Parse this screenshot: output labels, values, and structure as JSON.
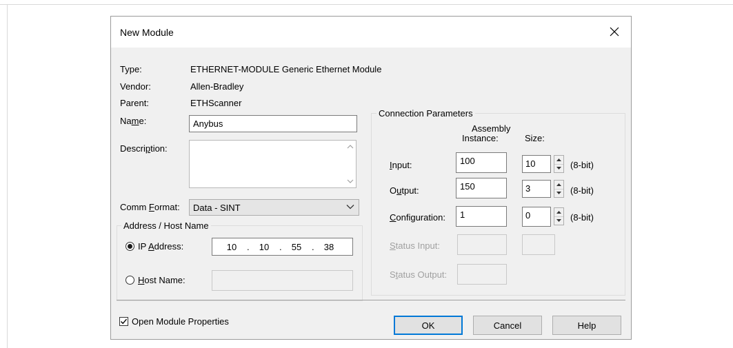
{
  "dialog": {
    "title": "New Module"
  },
  "module_info": {
    "type_label": "Type:",
    "type_value": "ETHERNET-MODULE Generic Ethernet Module",
    "vendor_label": "Vendor:",
    "vendor_value": "Allen-Bradley",
    "parent_label": "Parent:",
    "parent_value": "ETHScanner",
    "name_label_a": "Na",
    "name_label_u": "m",
    "name_label_b": "e:",
    "name_value": "Anybus",
    "description_label_a": "Descri",
    "description_label_u": "p",
    "description_label_b": "tion:",
    "description_value": ""
  },
  "comm_format": {
    "label_a": "Comm ",
    "label_u": "F",
    "label_b": "ormat:",
    "value": "Data - SINT"
  },
  "address": {
    "group_title": "Address / Host Name",
    "ip_label_a": "IP ",
    "ip_label_u": "A",
    "ip_label_b": "ddress:",
    "ip_octets": [
      "10",
      "10",
      "55",
      "38"
    ],
    "ip_selected": true,
    "host_label_a": "",
    "host_label_u": "H",
    "host_label_b": "ost Name:",
    "host_value": ""
  },
  "connection": {
    "group_title": "Connection Parameters",
    "col_assembly_line1": "Assembly",
    "col_assembly_line2": "Instance:",
    "col_size": "Size:",
    "input_label_u": "I",
    "input_label_b": "nput:",
    "input_instance": "100",
    "input_size": "10",
    "input_unit": "(8-bit)",
    "output_label_a": "O",
    "output_label_u": "u",
    "output_label_b": "tput:",
    "output_instance": "150",
    "output_size": "3",
    "output_unit": "(8-bit)",
    "config_label_u": "C",
    "config_label_b": "onfiguration:",
    "config_instance": "1",
    "config_size": "0",
    "config_unit": "(8-bit)",
    "status_input_label_u": "S",
    "status_input_label_b": "tatus Input:",
    "status_output_label_a": "S",
    "status_output_label_u": "t",
    "status_output_label_b": "atus Output:"
  },
  "footer": {
    "open_props_label": "Open Module Properties",
    "open_props_checked": true,
    "ok_label": "OK",
    "cancel_label": "Cancel",
    "help_label": "Help"
  }
}
